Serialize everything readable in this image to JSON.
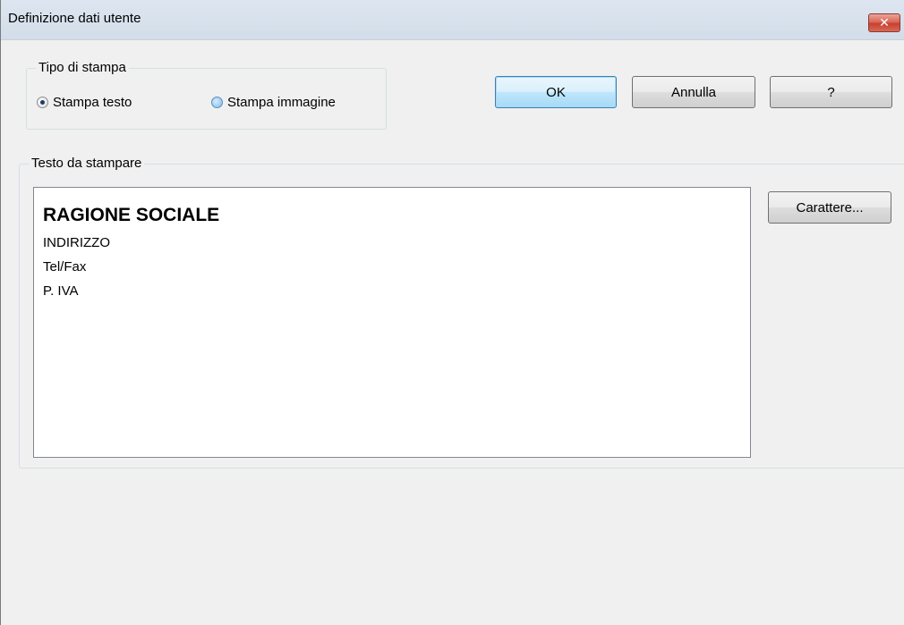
{
  "window": {
    "title": "Definizione dati utente",
    "close_glyph": "✕"
  },
  "print_type": {
    "label": "Tipo di stampa",
    "options": [
      {
        "label": "Stampa testo",
        "checked": true
      },
      {
        "label": "Stampa immagine",
        "checked": false
      }
    ]
  },
  "buttons": {
    "ok": "OK",
    "cancel": "Annulla",
    "help": "?",
    "font": "Carattere..."
  },
  "text_to_print": {
    "label": "Testo da stampare",
    "lines": [
      "RAGIONE SOCIALE",
      "INDIRIZZO",
      "Tel/Fax",
      "P. IVA"
    ]
  },
  "colors": {
    "titlebar": "#d3dde9",
    "close_button": "#c84030",
    "default_button_border": "#3c7fb1"
  }
}
